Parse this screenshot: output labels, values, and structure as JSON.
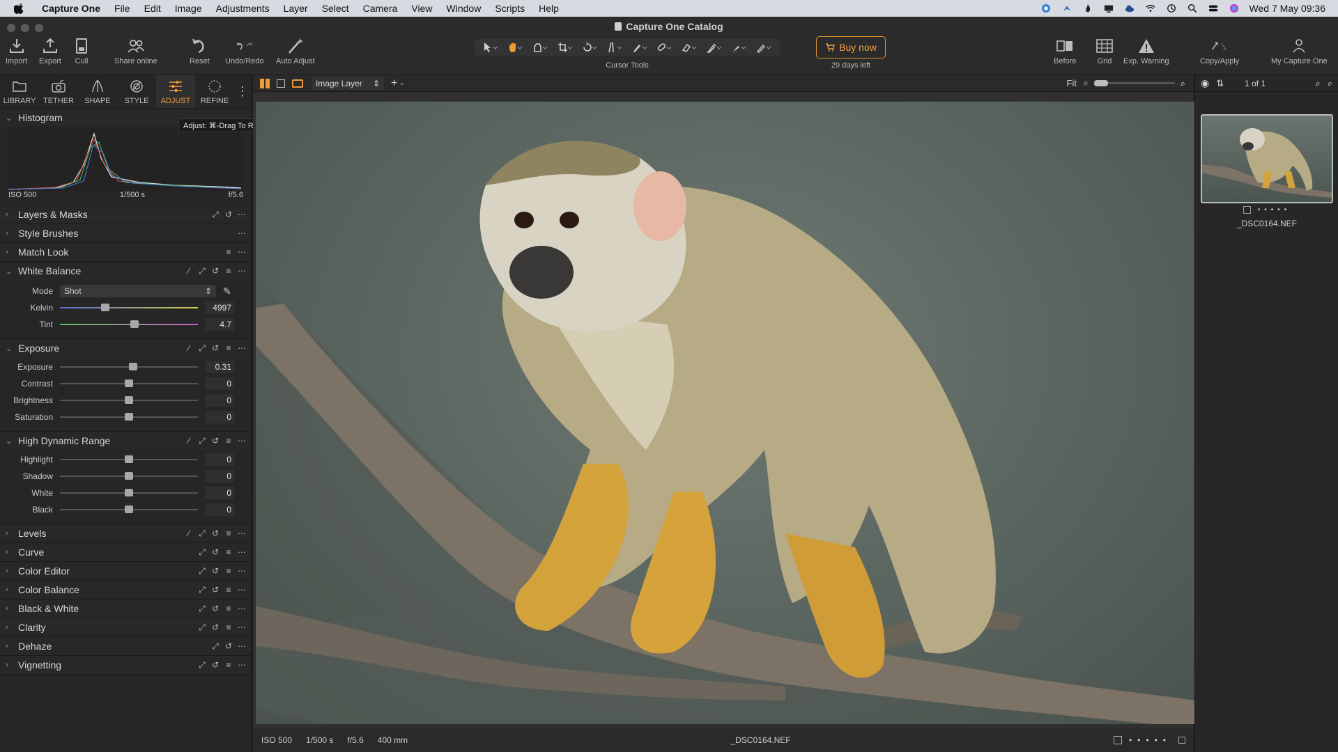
{
  "menubar": {
    "app_name": "Capture One",
    "items": [
      "File",
      "Edit",
      "Image",
      "Adjustments",
      "Layer",
      "Select",
      "Camera",
      "View",
      "Window",
      "Scripts",
      "Help"
    ],
    "clock": "Wed 7 May  09:36"
  },
  "window": {
    "title": "Capture One Catalog"
  },
  "toolbar": {
    "import": "Import",
    "export": "Export",
    "cull": "Cull",
    "share_online": "Share online",
    "reset": "Reset",
    "undo_redo": "Undo/Redo",
    "auto_adjust": "Auto Adjust",
    "cursor_tools": "Cursor Tools",
    "buy_now": "Buy now",
    "days_left": "29 days left",
    "before": "Before",
    "grid": "Grid",
    "exp_warning": "Exp. Warning",
    "copy_apply": "Copy/Apply",
    "my_capture_one": "My Capture One"
  },
  "tool_tabs": [
    "LIBRARY",
    "TETHER",
    "SHAPE",
    "STYLE",
    "ADJUST",
    "REFINE"
  ],
  "active_tab": "ADJUST",
  "tooltip": "Adjust: ⌘-Drag To Reorder",
  "histogram": {
    "title": "Histogram",
    "iso": "ISO 500",
    "shutter": "1/500 s",
    "aperture": "f/5.6"
  },
  "sections": {
    "layers_masks": "Layers & Masks",
    "style_brushes": "Style Brushes",
    "match_look": "Match Look",
    "white_balance": "White Balance",
    "exposure": "Exposure",
    "hdr": "High Dynamic Range",
    "levels": "Levels",
    "curve": "Curve",
    "color_editor": "Color Editor",
    "color_balance": "Color Balance",
    "black_white": "Black & White",
    "clarity": "Clarity",
    "dehaze": "Dehaze",
    "vignetting": "Vignetting"
  },
  "white_balance": {
    "mode_label": "Mode",
    "mode_value": "Shot",
    "kelvin_label": "Kelvin",
    "kelvin_value": "4997",
    "kelvin_fraction": 0.33,
    "tint_label": "Tint",
    "tint_value": "4.7",
    "tint_fraction": 0.54
  },
  "exposure": {
    "rows": [
      {
        "label": "Exposure",
        "value": "0.31",
        "fraction": 0.53
      },
      {
        "label": "Contrast",
        "value": "0",
        "fraction": 0.5
      },
      {
        "label": "Brightness",
        "value": "0",
        "fraction": 0.5
      },
      {
        "label": "Saturation",
        "value": "0",
        "fraction": 0.5
      }
    ]
  },
  "hdr": {
    "rows": [
      {
        "label": "Highlight",
        "value": "0",
        "fraction": 0.5
      },
      {
        "label": "Shadow",
        "value": "0",
        "fraction": 0.5
      },
      {
        "label": "White",
        "value": "0",
        "fraction": 0.5
      },
      {
        "label": "Black",
        "value": "0",
        "fraction": 0.5
      }
    ]
  },
  "viewer": {
    "layer_select": "Image Layer",
    "fit": "Fit",
    "footer": {
      "iso": "ISO 500",
      "shutter": "1/500 s",
      "aperture": "f/5.6",
      "focal": "400 mm",
      "filename": "_DSC0164.NEF"
    }
  },
  "browser": {
    "count": "1 of 1",
    "filename": "_DSC0164.NEF"
  },
  "colors": {
    "accent": "#f09a3a",
    "panel": "#262626",
    "viewer": "#303030"
  }
}
